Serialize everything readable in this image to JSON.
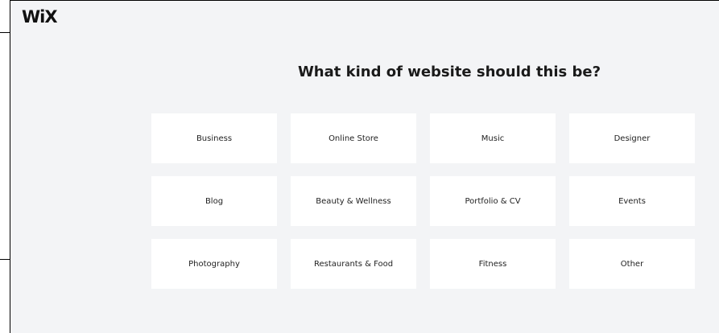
{
  "app": {
    "logo_text": "WiX"
  },
  "main": {
    "title": "What kind of website should this be?",
    "categories": [
      "Business",
      "Online Store",
      "Music",
      "Designer",
      "Blog",
      "Beauty & Wellness",
      "Portfolio & CV",
      "Events",
      "Photography",
      "Restaurants & Food",
      "Fitness",
      "Other"
    ]
  },
  "colors": {
    "background": "#f3f4f6",
    "tile_background": "#ffffff",
    "text": "#1a1a1a"
  }
}
